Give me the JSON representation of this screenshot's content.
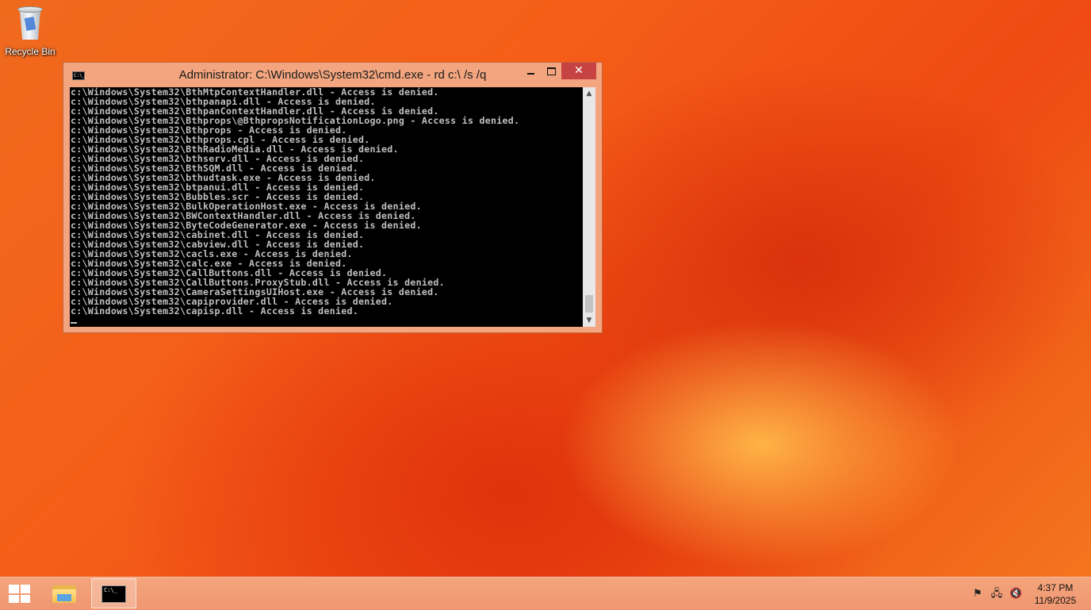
{
  "desktop": {
    "icons": [
      {
        "label": "Recycle Bin",
        "icon": "recycle-bin-icon"
      }
    ]
  },
  "window": {
    "title": "Administrator: C:\\Windows\\System32\\cmd.exe - rd  c:\\ /s /q",
    "icon": "cmd-icon",
    "icon_glyph": "C:\\_",
    "controls": {
      "minimize": "minimize-icon",
      "maximize": "maximize-icon",
      "close": "✕"
    },
    "accent": "#f2a57e",
    "close_color": "#c74343",
    "console_lines": [
      "c:\\Windows\\System32\\BthMtpContextHandler.dll - Access is denied.",
      "c:\\Windows\\System32\\bthpanapi.dll - Access is denied.",
      "c:\\Windows\\System32\\BthpanContextHandler.dll - Access is denied.",
      "c:\\Windows\\System32\\Bthprops\\@BthpropsNotificationLogo.png - Access is denied.",
      "c:\\Windows\\System32\\Bthprops - Access is denied.",
      "c:\\Windows\\System32\\bthprops.cpl - Access is denied.",
      "c:\\Windows\\System32\\BthRadioMedia.dll - Access is denied.",
      "c:\\Windows\\System32\\bthserv.dll - Access is denied.",
      "c:\\Windows\\System32\\BthSQM.dll - Access is denied.",
      "c:\\Windows\\System32\\bthudtask.exe - Access is denied.",
      "c:\\Windows\\System32\\btpanui.dll - Access is denied.",
      "c:\\Windows\\System32\\Bubbles.scr - Access is denied.",
      "c:\\Windows\\System32\\BulkOperationHost.exe - Access is denied.",
      "c:\\Windows\\System32\\BWContextHandler.dll - Access is denied.",
      "c:\\Windows\\System32\\ByteCodeGenerator.exe - Access is denied.",
      "c:\\Windows\\System32\\cabinet.dll - Access is denied.",
      "c:\\Windows\\System32\\cabview.dll - Access is denied.",
      "c:\\Windows\\System32\\cacls.exe - Access is denied.",
      "c:\\Windows\\System32\\calc.exe - Access is denied.",
      "c:\\Windows\\System32\\CallButtons.dll - Access is denied.",
      "c:\\Windows\\System32\\CallButtons.ProxyStub.dll - Access is denied.",
      "c:\\Windows\\System32\\CameraSettingsUIHost.exe - Access is denied.",
      "c:\\Windows\\System32\\capiprovider.dll - Access is denied.",
      "c:\\Windows\\System32\\capisp.dll - Access is denied."
    ]
  },
  "taskbar": {
    "start": "windows-logo-icon",
    "pinned": [
      {
        "name": "File Explorer",
        "icon": "file-explorer-icon"
      },
      {
        "name": "Command Prompt",
        "icon": "cmd-icon",
        "glyph": "C:\\_"
      }
    ],
    "tray": {
      "icons": [
        "action-center-flag-icon",
        "network-icon",
        "volume-muted-icon"
      ],
      "time": "4:37 PM",
      "date": "11/9/2025"
    }
  }
}
